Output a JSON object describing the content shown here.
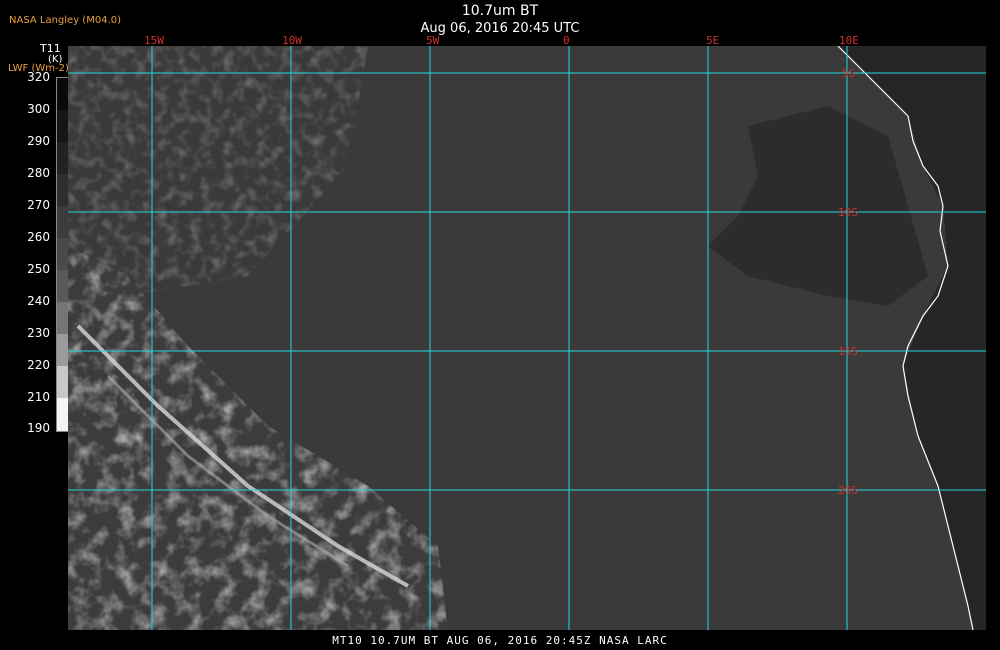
{
  "header": {
    "product": "NASA Langley (M04.0)",
    "title": "10.7um BT",
    "subtitle": "Aug 06, 2016 20:45 UTC"
  },
  "legend": {
    "variable": "T11",
    "unit": "(K)",
    "alt_variable": "LWF (Wm-2)",
    "ticks": [
      "320",
      "300",
      "290",
      "280",
      "270",
      "260",
      "250",
      "240",
      "230",
      "220",
      "210",
      "190"
    ]
  },
  "grid": {
    "lon_labels": [
      "15W",
      "10W",
      "5W",
      "0",
      "5E",
      "10E"
    ],
    "lat_labels": [
      "5S",
      "10S",
      "15S",
      "20S"
    ]
  },
  "footer": "MT10  10.7UM BT   AUG 06, 2016 20:45Z  NASA LARC",
  "colors": {
    "gridline": "#22d8e0",
    "grid_label": "#d03030",
    "coastline": "#ffffff",
    "product_label": "#e8a040",
    "ocean_bt": "#3a3a3a",
    "cold_cloud": "#c8c8c8",
    "land": "#2a2a2a"
  }
}
